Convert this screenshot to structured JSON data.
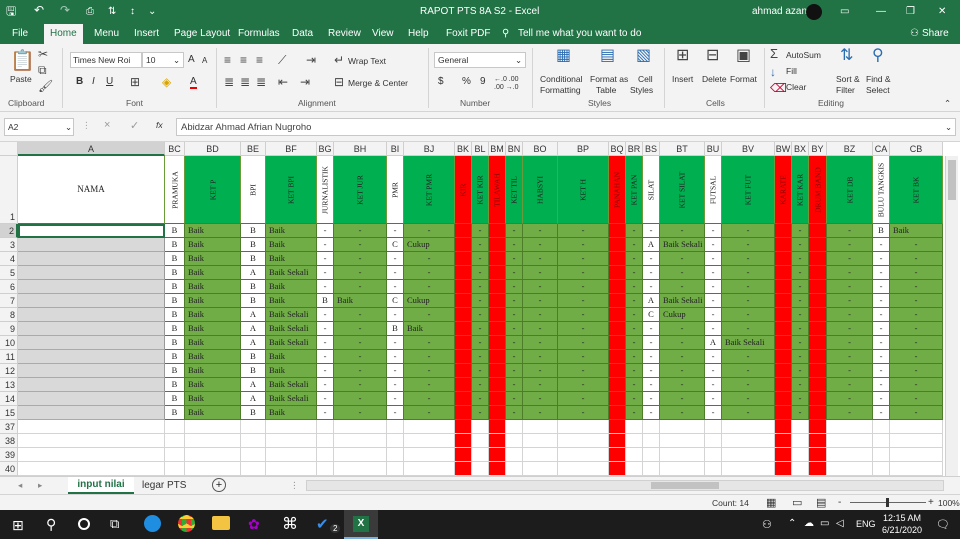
{
  "title_bar": {
    "title": "RAPOT PTS 8A S2  -  Excel",
    "user": "ahmad azan",
    "save_icon": "save-icon",
    "undo_icon": "undo-icon",
    "redo_icon": "redo-icon"
  },
  "menu": {
    "items": [
      "File",
      "Home",
      "Menu",
      "Insert",
      "Page Layout",
      "Formulas",
      "Data",
      "Review",
      "View",
      "Help",
      "Foxit PDF"
    ],
    "active": "Home",
    "tell_me": "Tell me what you want to do",
    "share": "Share"
  },
  "ribbon": {
    "clipboard": {
      "paste": "Paste",
      "label": "Clipboard"
    },
    "font": {
      "name": "Times New Roi",
      "size": "10",
      "label": "Font",
      "bold": "B",
      "italic": "I",
      "underline": "U",
      "grow": "A",
      "shrink": "A",
      "color": "A"
    },
    "alignment": {
      "wrap_text": "Wrap Text",
      "merge_center": "Merge & Center",
      "label": "Alignment"
    },
    "number": {
      "format": "General",
      "currency": "$",
      "percent": "%",
      "comma": "9",
      "inc_decimals": "←.0 .00",
      "dec_decimals": ".00 →.0",
      "label": "Number"
    },
    "styles": {
      "conditional": "Conditional",
      "conditional2": "Formatting",
      "format_as": "Format as",
      "format_as2": "Table",
      "cell_styles": "Cell",
      "cell_styles2": "Styles",
      "label": "Styles"
    },
    "cells": {
      "insert": "Insert",
      "delete": "Delete",
      "format": "Format",
      "label": "Cells"
    },
    "editing": {
      "autosum": "AutoSum",
      "fill": "Fill",
      "clear": "Clear",
      "sort_filter": "Sort &",
      "sort_filter2": "Filter",
      "find_select": "Find &",
      "find_select2": "Select",
      "label": "Editing"
    }
  },
  "formula_bar": {
    "name_box": "A2",
    "fx": "fx",
    "cancel": "×",
    "enter": "✓",
    "content": "Abidzar Ahmad Afrian Nugroho"
  },
  "grid": {
    "columns": [
      "A",
      "BC",
      "BD",
      "BE",
      "BF",
      "BG",
      "BH",
      "BI",
      "BJ",
      "BK",
      "BL",
      "BM",
      "BN",
      "BO",
      "BP",
      "BQ",
      "BR",
      "BS",
      "BT",
      "BU",
      "BV",
      "BW",
      "BX",
      "BY",
      "BZ",
      "CA",
      "CB"
    ],
    "headers": [
      "NAMA",
      "PRAMUKA",
      "KET P",
      "BPI",
      "KET BPI",
      "JURNALISTIK",
      "KET JUR",
      "PMR",
      "KET PMR",
      "KIR",
      "KET KIR",
      "TILAWAH",
      "KET TIL",
      "HABSYI",
      "KET H",
      "PANAHAN",
      "KET PAN",
      "SILAT",
      "KET SILAT",
      "FUTSAL",
      "KET FUT",
      "KARATE",
      "KET KAR",
      "DRUM BAND",
      "KET DB",
      "BULU TANGKIS",
      "KET BK"
    ],
    "row_numbers": [
      "1",
      "2",
      "3",
      "4",
      "5",
      "6",
      "7",
      "8",
      "9",
      "10",
      "11",
      "12",
      "13",
      "14",
      "15",
      "37",
      "38",
      "39",
      "40"
    ],
    "rows": [
      [
        "",
        "B",
        "Baik",
        "B",
        "Baik",
        "-",
        "-",
        "-",
        "-",
        "",
        "-",
        "",
        "-",
        "-",
        "-",
        "",
        "-",
        "-",
        "-",
        "-",
        "-",
        "",
        "-",
        "",
        "-",
        "B",
        "Baik"
      ],
      [
        "",
        "B",
        "Baik",
        "B",
        "Baik",
        "-",
        "-",
        "C",
        "Cukup",
        "",
        "-",
        "",
        "-",
        "-",
        "-",
        "",
        "-",
        "A",
        "Baik Sekali",
        "-",
        "-",
        "",
        "-",
        "",
        "-",
        "-",
        "-"
      ],
      [
        "",
        "B",
        "Baik",
        "B",
        "Baik",
        "-",
        "-",
        "-",
        "-",
        "",
        "-",
        "",
        "-",
        "-",
        "-",
        "",
        "-",
        "-",
        "-",
        "-",
        "-",
        "",
        "-",
        "",
        "-",
        "-",
        "-"
      ],
      [
        "",
        "B",
        "Baik",
        "A",
        "Baik Sekali",
        "-",
        "-",
        "-",
        "-",
        "",
        "-",
        "",
        "-",
        "-",
        "-",
        "",
        "-",
        "-",
        "-",
        "-",
        "-",
        "",
        "-",
        "",
        "-",
        "-",
        "-"
      ],
      [
        "",
        "B",
        "Baik",
        "B",
        "Baik",
        "-",
        "-",
        "-",
        "-",
        "",
        "-",
        "",
        "-",
        "-",
        "-",
        "",
        "-",
        "-",
        "-",
        "-",
        "-",
        "",
        "-",
        "",
        "-",
        "-",
        "-"
      ],
      [
        "",
        "B",
        "Baik",
        "B",
        "Baik",
        "B",
        "Baik",
        "C",
        "Cukup",
        "",
        "-",
        "",
        "-",
        "-",
        "-",
        "",
        "-",
        "A",
        "Baik Sekali",
        "-",
        "-",
        "",
        "-",
        "",
        "-",
        "-",
        "-"
      ],
      [
        "",
        "B",
        "Baik",
        "A",
        "Baik Sekali",
        "-",
        "-",
        "-",
        "-",
        "",
        "-",
        "",
        "-",
        "-",
        "-",
        "",
        "-",
        "C",
        "Cukup",
        "-",
        "-",
        "",
        "-",
        "",
        "-",
        "-",
        "-"
      ],
      [
        "",
        "B",
        "Baik",
        "A",
        "Baik Sekali",
        "-",
        "-",
        "B",
        "Baik",
        "",
        "-",
        "",
        "-",
        "-",
        "-",
        "",
        "-",
        "-",
        "-",
        "-",
        "-",
        "",
        "-",
        "",
        "-",
        "-",
        "-"
      ],
      [
        "",
        "B",
        "Baik",
        "A",
        "Baik Sekali",
        "-",
        "-",
        "-",
        "-",
        "",
        "-",
        "",
        "-",
        "-",
        "-",
        "",
        "-",
        "-",
        "-",
        "A",
        "Baik Sekali",
        "",
        "-",
        "",
        "-",
        "-",
        "-"
      ],
      [
        "",
        "B",
        "Baik",
        "B",
        "Baik",
        "-",
        "-",
        "-",
        "-",
        "",
        "-",
        "",
        "-",
        "-",
        "-",
        "",
        "-",
        "-",
        "-",
        "-",
        "-",
        "",
        "-",
        "",
        "-",
        "-",
        "-"
      ],
      [
        "",
        "B",
        "Baik",
        "B",
        "Baik",
        "-",
        "-",
        "-",
        "-",
        "",
        "-",
        "",
        "-",
        "-",
        "-",
        "",
        "-",
        "-",
        "-",
        "-",
        "-",
        "",
        "-",
        "",
        "-",
        "-",
        "-"
      ],
      [
        "",
        "B",
        "Baik",
        "A",
        "Baik Sekali",
        "-",
        "-",
        "-",
        "-",
        "",
        "-",
        "",
        "-",
        "-",
        "-",
        "",
        "-",
        "-",
        "-",
        "-",
        "-",
        "",
        "-",
        "",
        "-",
        "-",
        "-"
      ],
      [
        "",
        "B",
        "Baik",
        "A",
        "Baik Sekali",
        "-",
        "-",
        "-",
        "-",
        "",
        "-",
        "",
        "-",
        "-",
        "-",
        "",
        "-",
        "-",
        "-",
        "-",
        "-",
        "",
        "-",
        "",
        "-",
        "-",
        "-"
      ],
      [
        "",
        "B",
        "Baik",
        "B",
        "Baik",
        "-",
        "-",
        "-",
        "-",
        "",
        "-",
        "",
        "-",
        "-",
        "-",
        "",
        "-",
        "-",
        "-",
        "-",
        "-",
        "",
        "-",
        "",
        "-",
        "-",
        "-"
      ]
    ]
  },
  "sheets": {
    "tabs": [
      "input nilai",
      "legar PTS"
    ],
    "active": "input nilai",
    "add": "+"
  },
  "status": {
    "count": "Count: 14",
    "zoom": "100%",
    "zoom_out": "-",
    "zoom_in": "+"
  },
  "taskbar": {
    "time": "12:15 AM",
    "date": "6/21/2020",
    "lang": "ENG",
    "badge": "2"
  },
  "colors": {
    "excel_green": "#217346",
    "cell_green": "#70ad47",
    "header_green": "#00b050",
    "red": "#ff0000",
    "white_cell": "#ffffff"
  }
}
